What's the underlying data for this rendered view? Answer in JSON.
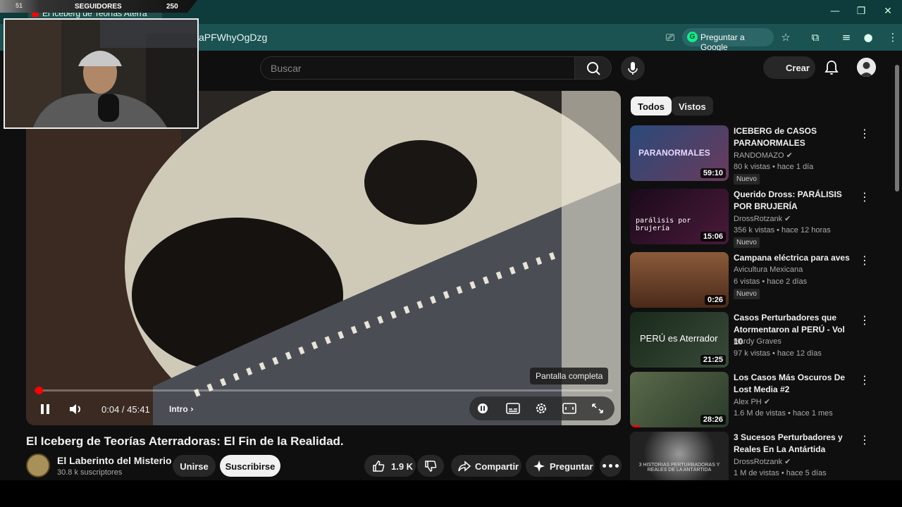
{
  "browser": {
    "tab_title": "El Iceberg de Teorías Aterra",
    "url": "aPFWhyOgDzg",
    "ask_google": "Preguntar a Google"
  },
  "overlay": {
    "followers_label": "SEGUIDORES",
    "followers_count": "250",
    "left_count": "51"
  },
  "header": {
    "search_placeholder": "Buscar",
    "create_label": "Crear"
  },
  "player": {
    "time": "0:04 / 45:41",
    "chapter": "Intro",
    "tooltip": "Pantalla completa",
    "progress_fraction": 0.0015
  },
  "video": {
    "title": "El Iceberg de Teorías Aterradoras: El Fin de la Realidad.",
    "channel": "El Laberinto del Misterio",
    "subscribers": "30.8 k suscriptores",
    "join_label": "Unirse",
    "subscribe_label": "Suscribirse",
    "likes": "1.9 K",
    "share_label": "Compartir",
    "ask_label": "Preguntar"
  },
  "chips": [
    "Todos",
    "Vistos"
  ],
  "recommendations": [
    {
      "title": "ICEBERG de CASOS PARANORMALES",
      "channel": "RANDOMAZO",
      "meta": "80 k vistas • hace 1 día",
      "badge": "Nuevo",
      "duration": "59:10",
      "thumb_text": "PARANORMALES",
      "color": "#3a5a8a"
    },
    {
      "title": "Querido Dross: PARÁLISIS POR BRUJERÍA",
      "channel": "DrossRotzank",
      "meta": "356 k vistas • hace 12 horas",
      "badge": "Nuevo",
      "duration": "15:06",
      "thumb_text": "parálisis por brujería",
      "color": "#3a1a3a"
    },
    {
      "title": "Campana eléctrica para aves",
      "channel": "Avicultura Mexicana",
      "meta": "6 vistas • hace 2 días",
      "badge": "Nuevo",
      "duration": "0:26",
      "thumb_text": "",
      "color": "#6a3a28"
    },
    {
      "title": "Casos Perturbadores que Atormentaron al PERÚ - Vol 10",
      "channel": "Hardy Graves",
      "meta": "97 k vistas • hace 12 días",
      "badge": "",
      "duration": "21:25",
      "thumb_text": "PERÚ es Aterrador",
      "color": "#2a3a2a"
    },
    {
      "title": "Los Casos Más Oscuros De Lost Media #2",
      "channel": "Alex PH",
      "meta": "1.6 M de vistas • hace 1 mes",
      "badge": "",
      "duration": "28:26",
      "thumb_text": "",
      "color": "#4a5a3a"
    },
    {
      "title": "3 Sucesos Perturbadores y Reales En La Antártida",
      "channel": "DrossRotzank",
      "meta": "1 M de vistas • hace 5 días",
      "badge": "",
      "duration": "",
      "thumb_text": "3 HISTORIAS PERTURBADORAS Y REALES DE LA ANTÁRTIDA",
      "color": "#2a2a2e"
    }
  ]
}
